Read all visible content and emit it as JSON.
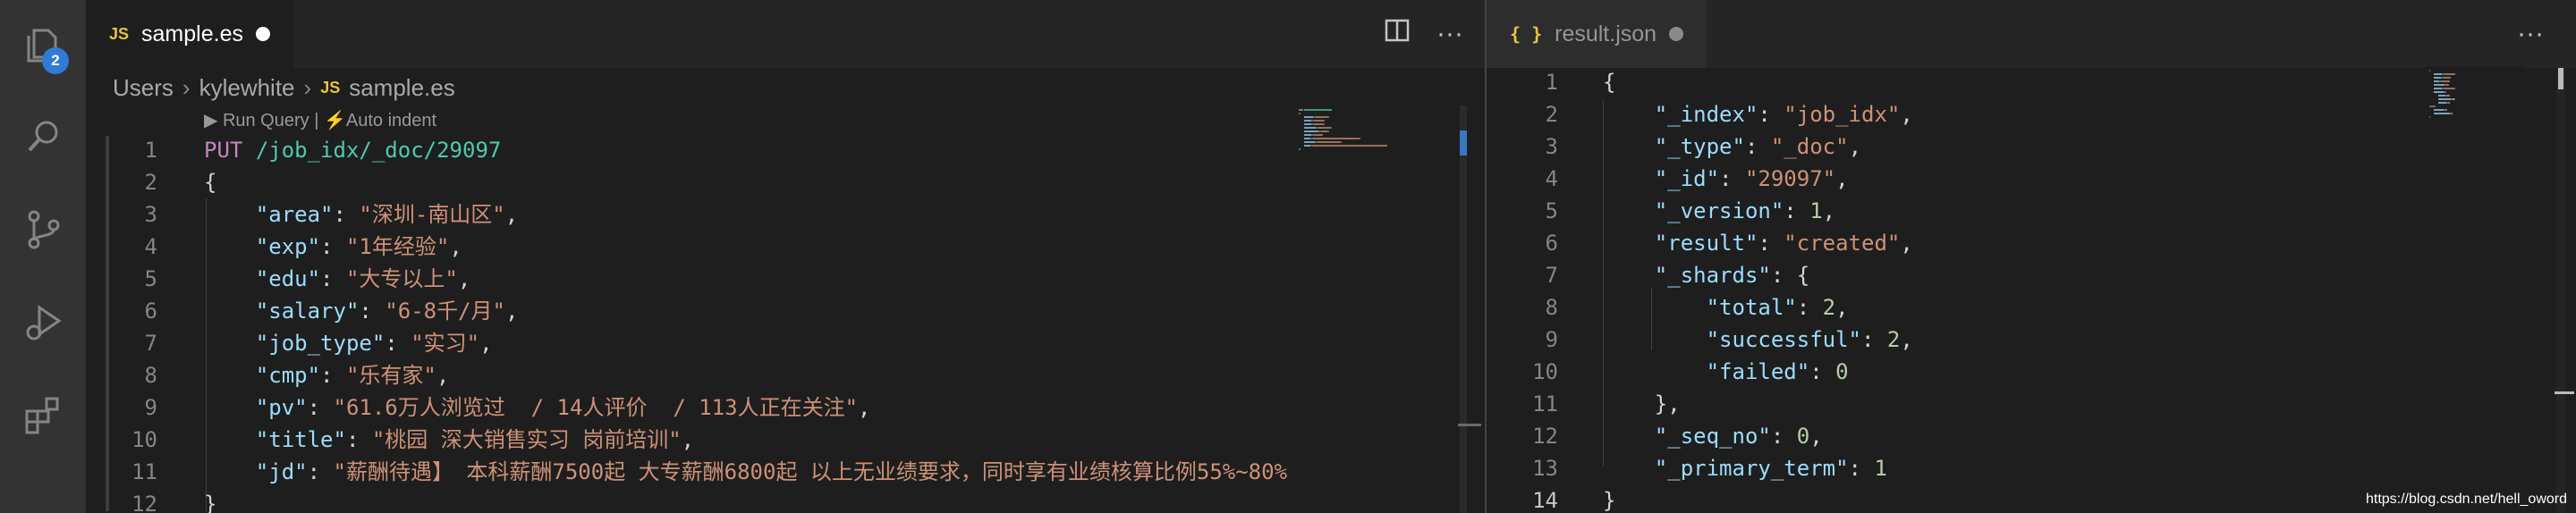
{
  "activity_bar": {
    "explorer_badge": "2",
    "icons": [
      "files-icon",
      "search-icon",
      "source-control-icon",
      "run-debug-icon",
      "extensions-icon"
    ]
  },
  "left_editor": {
    "tab": {
      "lang_badge": "JS",
      "file_name": "sample.es",
      "dirty": true
    },
    "actions": {
      "split": "split-editor-icon",
      "more": "···"
    },
    "breadcrumb": [
      "Users",
      "kylewhite",
      "sample.es"
    ],
    "breadcrumb_lang_badge": "JS",
    "codelens": {
      "run_query": "▶ Run Query",
      "separator": "|",
      "auto_indent": "⚡Auto indent"
    },
    "lines": [
      {
        "n": "1",
        "tokens": [
          [
            "kw",
            "PUT"
          ],
          [
            "p",
            " "
          ],
          [
            "url",
            "/job_idx/_doc/29097"
          ]
        ]
      },
      {
        "n": "2",
        "tokens": [
          [
            "p",
            "{"
          ]
        ]
      },
      {
        "n": "3",
        "tokens": [
          [
            "p",
            "    "
          ],
          [
            "k",
            "\"area\""
          ],
          [
            "p",
            ": "
          ],
          [
            "s",
            "\"深圳-南山区\""
          ],
          [
            "p",
            ","
          ]
        ]
      },
      {
        "n": "4",
        "tokens": [
          [
            "p",
            "    "
          ],
          [
            "k",
            "\"exp\""
          ],
          [
            "p",
            ": "
          ],
          [
            "s",
            "\"1年经验\""
          ],
          [
            "p",
            ","
          ]
        ]
      },
      {
        "n": "5",
        "tokens": [
          [
            "p",
            "    "
          ],
          [
            "k",
            "\"edu\""
          ],
          [
            "p",
            ": "
          ],
          [
            "s",
            "\"大专以上\""
          ],
          [
            "p",
            ","
          ]
        ]
      },
      {
        "n": "6",
        "tokens": [
          [
            "p",
            "    "
          ],
          [
            "k",
            "\"salary\""
          ],
          [
            "p",
            ": "
          ],
          [
            "s",
            "\"6-8千/月\""
          ],
          [
            "p",
            ","
          ]
        ]
      },
      {
        "n": "7",
        "tokens": [
          [
            "p",
            "    "
          ],
          [
            "k",
            "\"job_type\""
          ],
          [
            "p",
            ": "
          ],
          [
            "s",
            "\"实习\""
          ],
          [
            "p",
            ","
          ]
        ]
      },
      {
        "n": "8",
        "tokens": [
          [
            "p",
            "    "
          ],
          [
            "k",
            "\"cmp\""
          ],
          [
            "p",
            ": "
          ],
          [
            "s",
            "\"乐有家\""
          ],
          [
            "p",
            ","
          ]
        ]
      },
      {
        "n": "9",
        "tokens": [
          [
            "p",
            "    "
          ],
          [
            "k",
            "\"pv\""
          ],
          [
            "p",
            ": "
          ],
          [
            "s",
            "\"61.6万人浏览过  / 14人评价  / 113人正在关注\""
          ],
          [
            "p",
            ","
          ]
        ]
      },
      {
        "n": "10",
        "tokens": [
          [
            "p",
            "    "
          ],
          [
            "k",
            "\"title\""
          ],
          [
            "p",
            ": "
          ],
          [
            "s",
            "\"桃园 深大销售实习 岗前培训\""
          ],
          [
            "p",
            ","
          ]
        ]
      },
      {
        "n": "11",
        "tokens": [
          [
            "p",
            "    "
          ],
          [
            "k",
            "\"jd\""
          ],
          [
            "p",
            ": "
          ],
          [
            "s",
            "\"薪酬待遇】 本科薪酬7500起 大专薪酬6800起 以上无业绩要求，同时享有业绩核算比例55%~80%"
          ]
        ]
      },
      {
        "n": "12",
        "tokens": [
          [
            "p",
            "}"
          ]
        ]
      }
    ]
  },
  "right_editor": {
    "tab": {
      "lang_badge": "{ }",
      "file_name": "result.json",
      "dirty": true
    },
    "actions": {
      "more": "···"
    },
    "lines": [
      {
        "n": "1",
        "tokens": [
          [
            "p",
            "{"
          ]
        ]
      },
      {
        "n": "2",
        "tokens": [
          [
            "p",
            "    "
          ],
          [
            "k",
            "\"_index\""
          ],
          [
            "p",
            ": "
          ],
          [
            "s",
            "\"job_idx\""
          ],
          [
            "p",
            ","
          ]
        ]
      },
      {
        "n": "3",
        "tokens": [
          [
            "p",
            "    "
          ],
          [
            "k",
            "\"_type\""
          ],
          [
            "p",
            ": "
          ],
          [
            "s",
            "\"_doc\""
          ],
          [
            "p",
            ","
          ]
        ]
      },
      {
        "n": "4",
        "tokens": [
          [
            "p",
            "    "
          ],
          [
            "k",
            "\"_id\""
          ],
          [
            "p",
            ": "
          ],
          [
            "s",
            "\"29097\""
          ],
          [
            "p",
            ","
          ]
        ]
      },
      {
        "n": "5",
        "tokens": [
          [
            "p",
            "    "
          ],
          [
            "k",
            "\"_version\""
          ],
          [
            "p",
            ": "
          ],
          [
            "n",
            "1"
          ],
          [
            "p",
            ","
          ]
        ]
      },
      {
        "n": "6",
        "tokens": [
          [
            "p",
            "    "
          ],
          [
            "k",
            "\"result\""
          ],
          [
            "p",
            ": "
          ],
          [
            "s",
            "\"created\""
          ],
          [
            "p",
            ","
          ]
        ]
      },
      {
        "n": "7",
        "tokens": [
          [
            "p",
            "    "
          ],
          [
            "k",
            "\"_shards\""
          ],
          [
            "p",
            ": {"
          ]
        ]
      },
      {
        "n": "8",
        "tokens": [
          [
            "p",
            "        "
          ],
          [
            "k",
            "\"total\""
          ],
          [
            "p",
            ": "
          ],
          [
            "n",
            "2"
          ],
          [
            "p",
            ","
          ]
        ]
      },
      {
        "n": "9",
        "tokens": [
          [
            "p",
            "        "
          ],
          [
            "k",
            "\"successful\""
          ],
          [
            "p",
            ": "
          ],
          [
            "n",
            "2"
          ],
          [
            "p",
            ","
          ]
        ]
      },
      {
        "n": "10",
        "tokens": [
          [
            "p",
            "        "
          ],
          [
            "k",
            "\"failed\""
          ],
          [
            "p",
            ": "
          ],
          [
            "n",
            "0"
          ]
        ]
      },
      {
        "n": "11",
        "tokens": [
          [
            "p",
            "    },"
          ]
        ]
      },
      {
        "n": "12",
        "tokens": [
          [
            "p",
            "    "
          ],
          [
            "k",
            "\"_seq_no\""
          ],
          [
            "p",
            ": "
          ],
          [
            "n",
            "0"
          ],
          [
            "p",
            ","
          ]
        ]
      },
      {
        "n": "13",
        "tokens": [
          [
            "p",
            "    "
          ],
          [
            "k",
            "\"_primary_term\""
          ],
          [
            "p",
            ": "
          ],
          [
            "n",
            "1"
          ]
        ]
      },
      {
        "n": "14",
        "tokens": [
          [
            "p",
            "}"
          ]
        ]
      }
    ]
  },
  "watermark": "https://blog.csdn.net/hell_oword",
  "colors": {
    "key": "#9cdcfe",
    "string": "#ce9178",
    "number": "#b5cea8",
    "method": "#c586c0",
    "url": "#4ec9b0",
    "badge": "#2f7bd6"
  }
}
